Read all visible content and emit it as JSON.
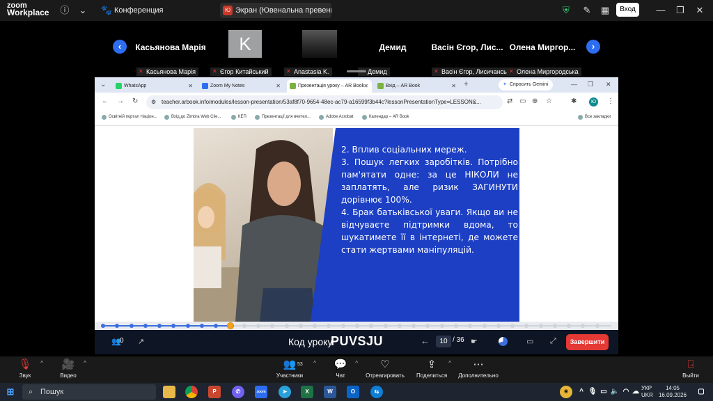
{
  "zoom": {
    "logo_line1": "zoom",
    "logo_line2": "Workplace",
    "conference_label": "Конференция",
    "screen_tab": "Экран (Ювенальна превенція Л",
    "screen_tab_badge": "Ю",
    "login_button": "Вход"
  },
  "participants": {
    "tiles": [
      {
        "name": "Касьянова Марія",
        "label": "Касьянова Марія"
      },
      {
        "initial": "K",
        "label": "Єгор Китайський"
      },
      {
        "label": "Anastasia K."
      },
      {
        "name": "Демид",
        "label": "Демид"
      },
      {
        "name": "Васін Єгор, Лис...",
        "label": "Васін Єгор, Лисичансь..."
      },
      {
        "name": "Олена Миргор...",
        "label": "Олена Миргородська"
      }
    ]
  },
  "browser": {
    "tabs": [
      {
        "label": "WhatsApp",
        "color": "#25d366"
      },
      {
        "label": "Zoom My Notes",
        "color": "#2d6df0"
      },
      {
        "label": "Презентація уроку – AR Book",
        "color": "#7bb241",
        "active": true
      },
      {
        "label": "Вхід – AR Book",
        "color": "#7bb241"
      }
    ],
    "gemini_button": "Спросить Gemini",
    "url": "teacher.arbook.info/modules/lesson-presentation/53af8f70-9654-48ec-ac79-a16599f3b44c?lessonPresentationType=LESSON&...",
    "bookmarks": [
      "Освітній портал Націон...",
      "Вхід до Zimbra Web Clie...",
      "КЕП",
      "Презентації для вчител...",
      "Adobe Acrobat",
      "Календар – AR Book"
    ],
    "all_bookmarks": "Все закладки",
    "profile_initial": "Ю"
  },
  "slide": {
    "paragraphs": [
      "2. Вплив соціальних мереж.",
      "3. Пошук легких заробітків. Потрібно пам'ятати одне: за це НІКОЛИ не заплатять, але ризик ЗАГИНУТИ дорівнює 100%.",
      "4. Брак батьківської уваги. Якщо ви не відчуваєте підтримки вдома, то шукатимете її в інтернеті, де можете стати жертвами маніпуляцій."
    ],
    "accent_color": "#1c3fc4"
  },
  "presenter_bar": {
    "viewers_count": "0",
    "code_label": "Код уроку",
    "code_value": "PUVSJU",
    "current_page": "10",
    "total_pages": "/ 36",
    "progress_fraction": 0.25,
    "finish_button": "Завершити"
  },
  "zoom_controls": {
    "audio": "Звук",
    "video": "Видео",
    "participants": "Участники",
    "participants_count": "53",
    "chat": "Чат",
    "react": "Отреагировать",
    "share": "Поделиться",
    "more": "Дополнительно",
    "leave": "Выйти"
  },
  "taskbar": {
    "search_placeholder": "Пошук",
    "language_line1": "УКР",
    "language_line2": "UKR",
    "time": "14:05",
    "date": "16.09.2026"
  }
}
